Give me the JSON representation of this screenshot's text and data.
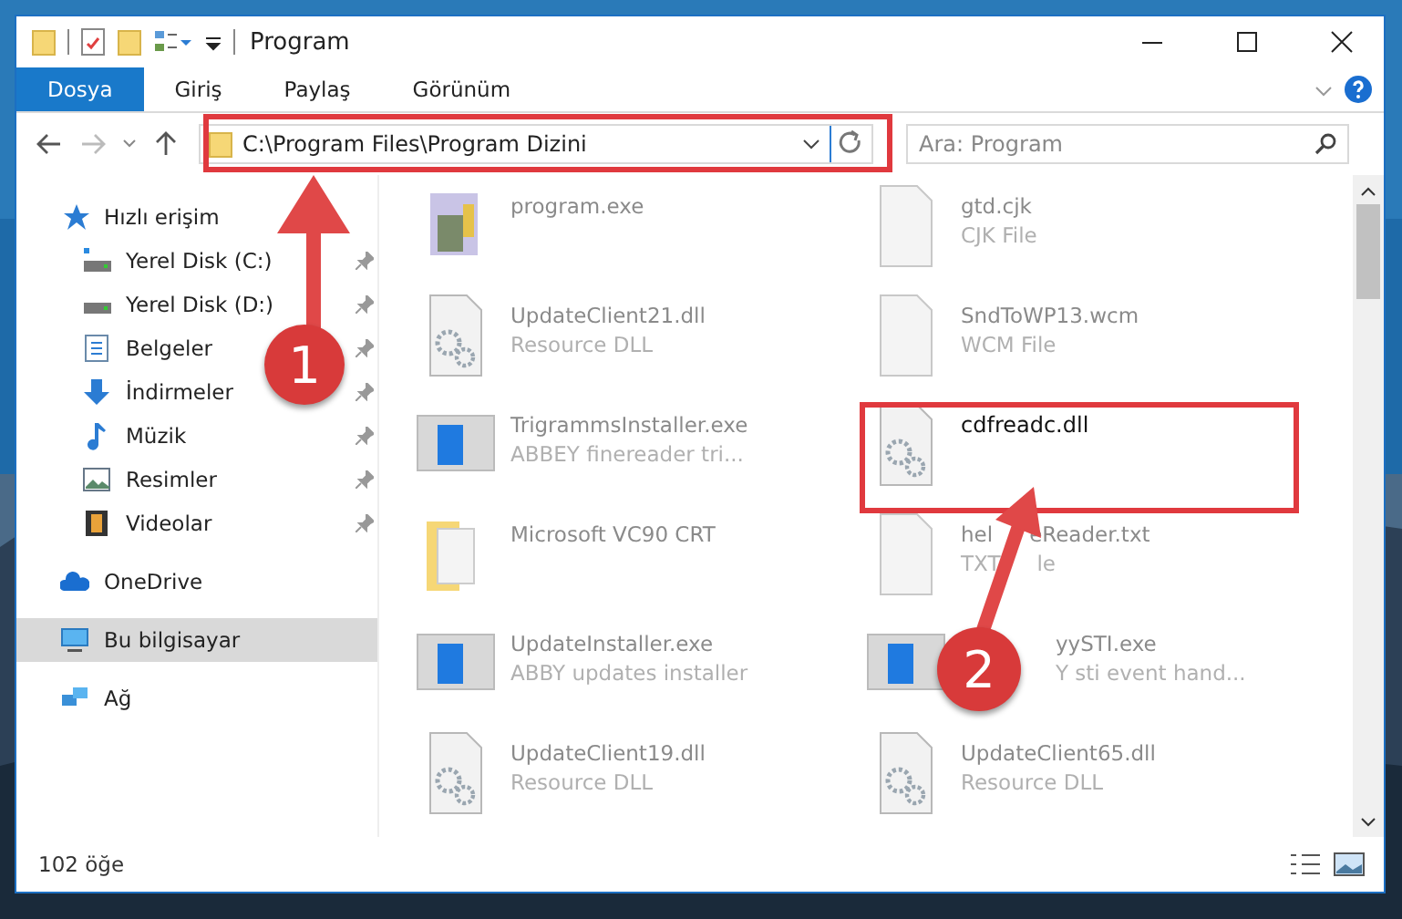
{
  "window": {
    "title": "Program"
  },
  "ribbon_tabs": [
    {
      "label": "Dosya",
      "selected": true
    },
    {
      "label": "Giriş",
      "selected": false
    },
    {
      "label": "Paylaş",
      "selected": false
    },
    {
      "label": "Görünüm",
      "selected": false
    }
  ],
  "address": {
    "value": "C:\\Program Files\\Program Dizini"
  },
  "search": {
    "placeholder": "Ara: Program"
  },
  "sidebar": {
    "items": [
      {
        "label": "Hızlı erişim",
        "kind": "group",
        "selected": false
      },
      {
        "label": "Yerel Disk (C:)",
        "kind": "child",
        "pinned": true,
        "selected": false
      },
      {
        "label": "Yerel Disk (D:)",
        "kind": "child",
        "pinned": true,
        "selected": false
      },
      {
        "label": "Belgeler",
        "kind": "child",
        "pinned": true,
        "selected": false
      },
      {
        "label": "İndirmeler",
        "kind": "child",
        "pinned": true,
        "selected": false
      },
      {
        "label": "Müzik",
        "kind": "child",
        "pinned": true,
        "selected": false
      },
      {
        "label": "Resimler",
        "kind": "child",
        "pinned": true,
        "selected": false
      },
      {
        "label": "Videolar",
        "kind": "child",
        "pinned": true,
        "selected": false
      },
      {
        "label": "OneDrive",
        "kind": "group",
        "selected": false
      },
      {
        "label": "Bu bilgisayar",
        "kind": "group",
        "selected": true
      },
      {
        "label": "Ağ",
        "kind": "group",
        "selected": false
      }
    ]
  },
  "files": [
    {
      "name": [
        "program.exe"
      ],
      "selected": false
    },
    {
      "name": [
        "gtd.cjk"
      ],
      "type": [
        "CJK File"
      ],
      "selected": false
    },
    {
      "name": [
        "UpdateClient21.dll"
      ],
      "type": [
        "Resource DLL"
      ],
      "selected": false
    },
    {
      "name": [
        "SndToWP13.wcm"
      ],
      "type": [
        "WCM File"
      ],
      "selected": false
    },
    {
      "name": [
        "TrigrammsInstaller.exe"
      ],
      "type": [
        "ABBEY finereader tri..."
      ],
      "selected": false
    },
    {
      "name": [
        "cdfreadc.dll"
      ],
      "selected": true
    },
    {
      "name": [
        "Microsoft VC90 CRT"
      ],
      "selected": false
    },
    {
      "name": [
        "hel",
        "eReader.txt"
      ],
      "type": [
        "TXT",
        "le"
      ],
      "selected": false
    },
    {
      "name": [
        "UpdateInstaller.exe"
      ],
      "type": [
        "ABBY updates installer"
      ],
      "selected": false
    },
    {
      "name": [
        "yySTI.exe"
      ],
      "type": [
        "Y sti event hand..."
      ],
      "lead_hidden": true,
      "selected": false
    },
    {
      "name": [
        "UpdateClient19.dll"
      ],
      "type": [
        "Resource DLL"
      ],
      "selected": false
    },
    {
      "name": [
        "UpdateClient65.dll"
      ],
      "type": [
        "Resource DLL"
      ],
      "selected": false
    }
  ],
  "status_bar": {
    "count": "102 öğe"
  },
  "annotations": [
    {
      "number": "1"
    },
    {
      "number": "2"
    }
  ]
}
